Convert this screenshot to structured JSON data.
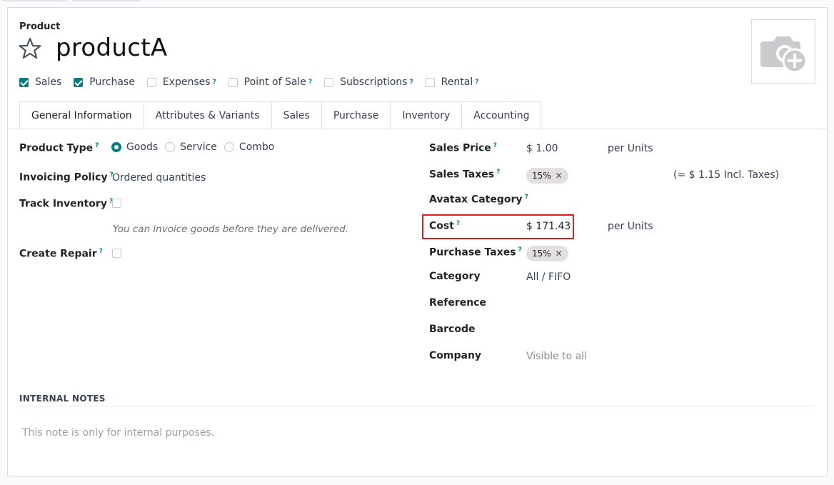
{
  "header": {
    "record_type": "Product",
    "title": "productA"
  },
  "flags": [
    {
      "label": "Sales",
      "checked": true,
      "help": ""
    },
    {
      "label": "Purchase",
      "checked": true,
      "help": ""
    },
    {
      "label": "Expenses",
      "checked": false,
      "help": "?"
    },
    {
      "label": "Point of Sale",
      "checked": false,
      "help": "?"
    },
    {
      "label": "Subscriptions",
      "checked": false,
      "help": "?"
    },
    {
      "label": "Rental",
      "checked": false,
      "help": "?"
    }
  ],
  "tabs": [
    {
      "label": "General Information",
      "active": true
    },
    {
      "label": "Attributes & Variants",
      "active": false
    },
    {
      "label": "Sales",
      "active": false
    },
    {
      "label": "Purchase",
      "active": false
    },
    {
      "label": "Inventory",
      "active": false
    },
    {
      "label": "Accounting",
      "active": false
    }
  ],
  "left": {
    "product_type": {
      "label": "Product Type",
      "help": "?",
      "options": [
        "Goods",
        "Service",
        "Combo"
      ],
      "selected": "Goods"
    },
    "invoicing_policy": {
      "label": "Invoicing Policy",
      "help": "?",
      "value": "Ordered quantities"
    },
    "track_inventory": {
      "label": "Track Inventory",
      "help": "?",
      "checked": false
    },
    "invoice_hint": "You can invoice goods before they are delivered.",
    "create_repair": {
      "label": "Create Repair",
      "help": "?",
      "checked": false
    }
  },
  "right": {
    "sales_price": {
      "label": "Sales Price",
      "help": "?",
      "value": "$ 1.00",
      "unit": "per Units"
    },
    "sales_taxes": {
      "label": "Sales Taxes",
      "help": "?",
      "tag": "15%",
      "tag_remove": "✕",
      "incl": "(= $ 1.15 Incl. Taxes)"
    },
    "avatax_category": {
      "label": "Avatax Category",
      "help": "?"
    },
    "cost": {
      "label": "Cost",
      "help": "?",
      "value": "$ 171.43",
      "unit": "per Units"
    },
    "purchase_taxes": {
      "label": "Purchase Taxes",
      "help": "?",
      "tag": "15%",
      "tag_remove": "✕"
    },
    "category": {
      "label": "Category",
      "value": "All / FIFO"
    },
    "reference": {
      "label": "Reference"
    },
    "barcode": {
      "label": "Barcode"
    },
    "company": {
      "label": "Company",
      "placeholder": "Visible to all"
    }
  },
  "notes": {
    "heading": "INTERNAL NOTES",
    "placeholder": "This note is only for internal purposes."
  },
  "colors": {
    "accent": "#017e84",
    "highlight": "#e11d1d",
    "tag_bg": "#e4dfdf"
  }
}
